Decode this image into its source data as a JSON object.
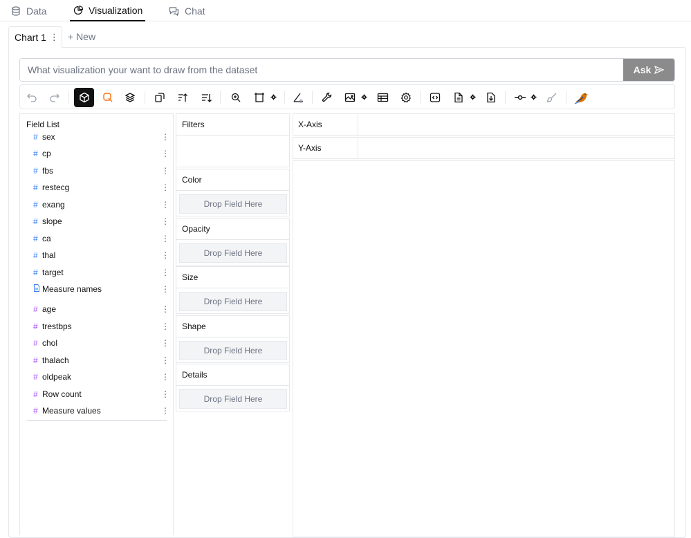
{
  "top_tabs": [
    {
      "label": "Data",
      "icon": "database-icon",
      "active": false
    },
    {
      "label": "Visualization",
      "icon": "pie-chart-icon",
      "active": true
    },
    {
      "label": "Chat",
      "icon": "chat-icon",
      "active": false
    }
  ],
  "chart_tabs": {
    "current": "Chart 1",
    "more": "⋮",
    "new_label": "+ New"
  },
  "ask": {
    "placeholder": "What visualization your want to draw from the dataset",
    "value": "",
    "button_label": "Ask"
  },
  "toolbar": {
    "items": [
      "undo-icon",
      "redo-icon",
      "cube-icon",
      "lasso-icon",
      "layers-icon",
      "transpose-icon",
      "sort-ascending-icon",
      "sort-descending-icon",
      "zoom-icon",
      "size-mode-icon",
      "axis-icon",
      "wrench-icon",
      "image-icon",
      "table-icon",
      "settings-icon",
      "code-icon",
      "export-file-icon",
      "download-icon",
      "link-icon",
      "brush-icon",
      "bird-logo-icon"
    ],
    "selected": "cube-icon"
  },
  "field_list": {
    "title": "Field List",
    "more_glyph": "⋮",
    "dimensions": [
      {
        "name": "sex",
        "type": "#"
      },
      {
        "name": "cp",
        "type": "#"
      },
      {
        "name": "fbs",
        "type": "#"
      },
      {
        "name": "restecg",
        "type": "#"
      },
      {
        "name": "exang",
        "type": "#"
      },
      {
        "name": "slope",
        "type": "#"
      },
      {
        "name": "ca",
        "type": "#"
      },
      {
        "name": "thal",
        "type": "#"
      },
      {
        "name": "target",
        "type": "#"
      },
      {
        "name": "Measure names",
        "type": "doc"
      }
    ],
    "measures": [
      {
        "name": "age",
        "type": "#"
      },
      {
        "name": "trestbps",
        "type": "#"
      },
      {
        "name": "chol",
        "type": "#"
      },
      {
        "name": "thalach",
        "type": "#"
      },
      {
        "name": "oldpeak",
        "type": "#"
      },
      {
        "name": "Row count",
        "type": "#"
      },
      {
        "name": "Measure values",
        "type": "#"
      }
    ]
  },
  "encodings": {
    "filters": "Filters",
    "drop_label": "Drop Field Here",
    "channels": [
      "Color",
      "Opacity",
      "Size",
      "Shape",
      "Details"
    ]
  },
  "axes": {
    "x": "X-Axis",
    "y": "Y-Axis"
  },
  "colors": {
    "dimension": "#3b82f6",
    "measure": "#a855f7",
    "ask_button": "#8b8b8b",
    "lasso": "#f97316"
  }
}
